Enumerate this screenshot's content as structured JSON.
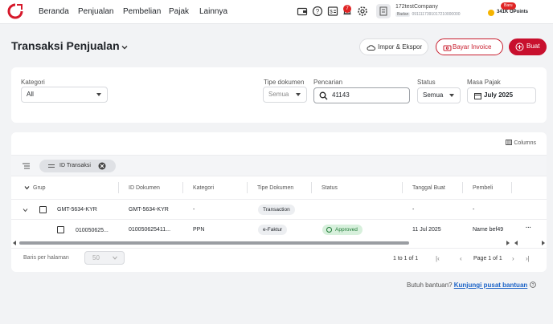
{
  "nav": {
    "items": [
      "Beranda",
      "Penjualan",
      "Pembelian",
      "Pajak",
      "Lainnya"
    ],
    "notification_count": "7"
  },
  "company": {
    "name": "172testCompany",
    "tag": "Badan",
    "npwp": "0911117391017210000000",
    "new_badge": "Baru",
    "points": "341K OPoints"
  },
  "page": {
    "title": "Transaksi Penjualan",
    "actions": {
      "import_label": "Impor & Ekspor",
      "pay_label": "Bayar Invoice",
      "create_label": "Buat"
    }
  },
  "filters": {
    "kategori": {
      "label": "Kategori",
      "value": "All"
    },
    "tipe_dokumen": {
      "label": "Tipe dokumen",
      "value": "Semua"
    },
    "pencarian": {
      "label": "Pencarian",
      "value": "41143"
    },
    "status": {
      "label": "Status",
      "value": "Semua"
    },
    "masa_pajak": {
      "label": "Masa Pajak",
      "value": "July 2025"
    }
  },
  "table": {
    "columns_button": "Columns",
    "group_chip": "ID Transaksi",
    "headers": [
      "Grup",
      "ID Dokumen",
      "Kategori",
      "Tipe Dokumen",
      "Status",
      "Tanggal Buat",
      "Pembeli"
    ],
    "group_row": {
      "grup": "GMT-5634-KYR",
      "id_dokumen": "GMT-5634-KYR",
      "kategori": "-",
      "tipe_dokumen": "Transaction",
      "tanggal": "-",
      "pembeli": "-"
    },
    "detail_row": {
      "grup": "010050625...",
      "id_dokumen": "010050625411...",
      "kategori": "PPN",
      "tipe_dokumen": "e-Faktur",
      "status": "Approved",
      "tanggal": "11 Jul 2025",
      "pembeli": "Name bef49",
      "more": "···"
    }
  },
  "pagination": {
    "rows_label": "Baris per halaman",
    "rows_value": "50",
    "range": "1 to 1 of 1",
    "page": "Page 1 of 1"
  },
  "help": {
    "text": "Butuh bantuan?",
    "link": "Kunjungi pusat bantuan"
  },
  "colors": {
    "brand": "#c8102e",
    "approved_bg": "#d7f0dc",
    "link": "#1a62c7"
  }
}
